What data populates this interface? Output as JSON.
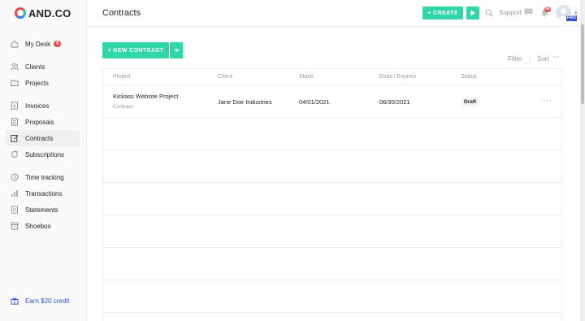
{
  "logo": {
    "text": "AND.CO"
  },
  "sidebar": {
    "items": [
      {
        "label": "My Desk",
        "icon": "home-icon",
        "badge": "9"
      },
      {
        "label": "Clients",
        "icon": "users-icon"
      },
      {
        "label": "Projects",
        "icon": "folder-icon"
      },
      {
        "label": "Invoices",
        "icon": "invoice-icon"
      },
      {
        "label": "Proposals",
        "icon": "proposal-icon"
      },
      {
        "label": "Contracts",
        "icon": "contract-edit-icon",
        "active": true
      },
      {
        "label": "Subscriptions",
        "icon": "refresh-icon"
      },
      {
        "label": "Time tracking",
        "icon": "clock-icon"
      },
      {
        "label": "Transactions",
        "icon": "bar-chart-icon"
      },
      {
        "label": "Statements",
        "icon": "statement-icon"
      },
      {
        "label": "Shoebox",
        "icon": "archive-icon"
      }
    ],
    "earn": "Earn $20 credit"
  },
  "header": {
    "title": "Contracts",
    "create_label": "+ CREATE",
    "support_label": "Support",
    "notif_count": "58",
    "pro_badge": "PRO"
  },
  "toolbar": {
    "new_contract_label": "+ NEW CONTRACT",
    "filter_label": "Filter",
    "sort_label": "Sort"
  },
  "table": {
    "columns": [
      "Project",
      "Client",
      "Starts",
      "Ends / Expires",
      "Status"
    ],
    "rows": [
      {
        "project": "Kickass Website Project",
        "type": "Contract",
        "client": "Jane Doe Industries",
        "starts": "04/01/2021",
        "ends": "06/30/2021",
        "status": "Draft"
      }
    ]
  },
  "colors": {
    "accent": "#2fd7a6",
    "badge_red": "#e54b4b",
    "link_blue": "#2b4fd0"
  }
}
